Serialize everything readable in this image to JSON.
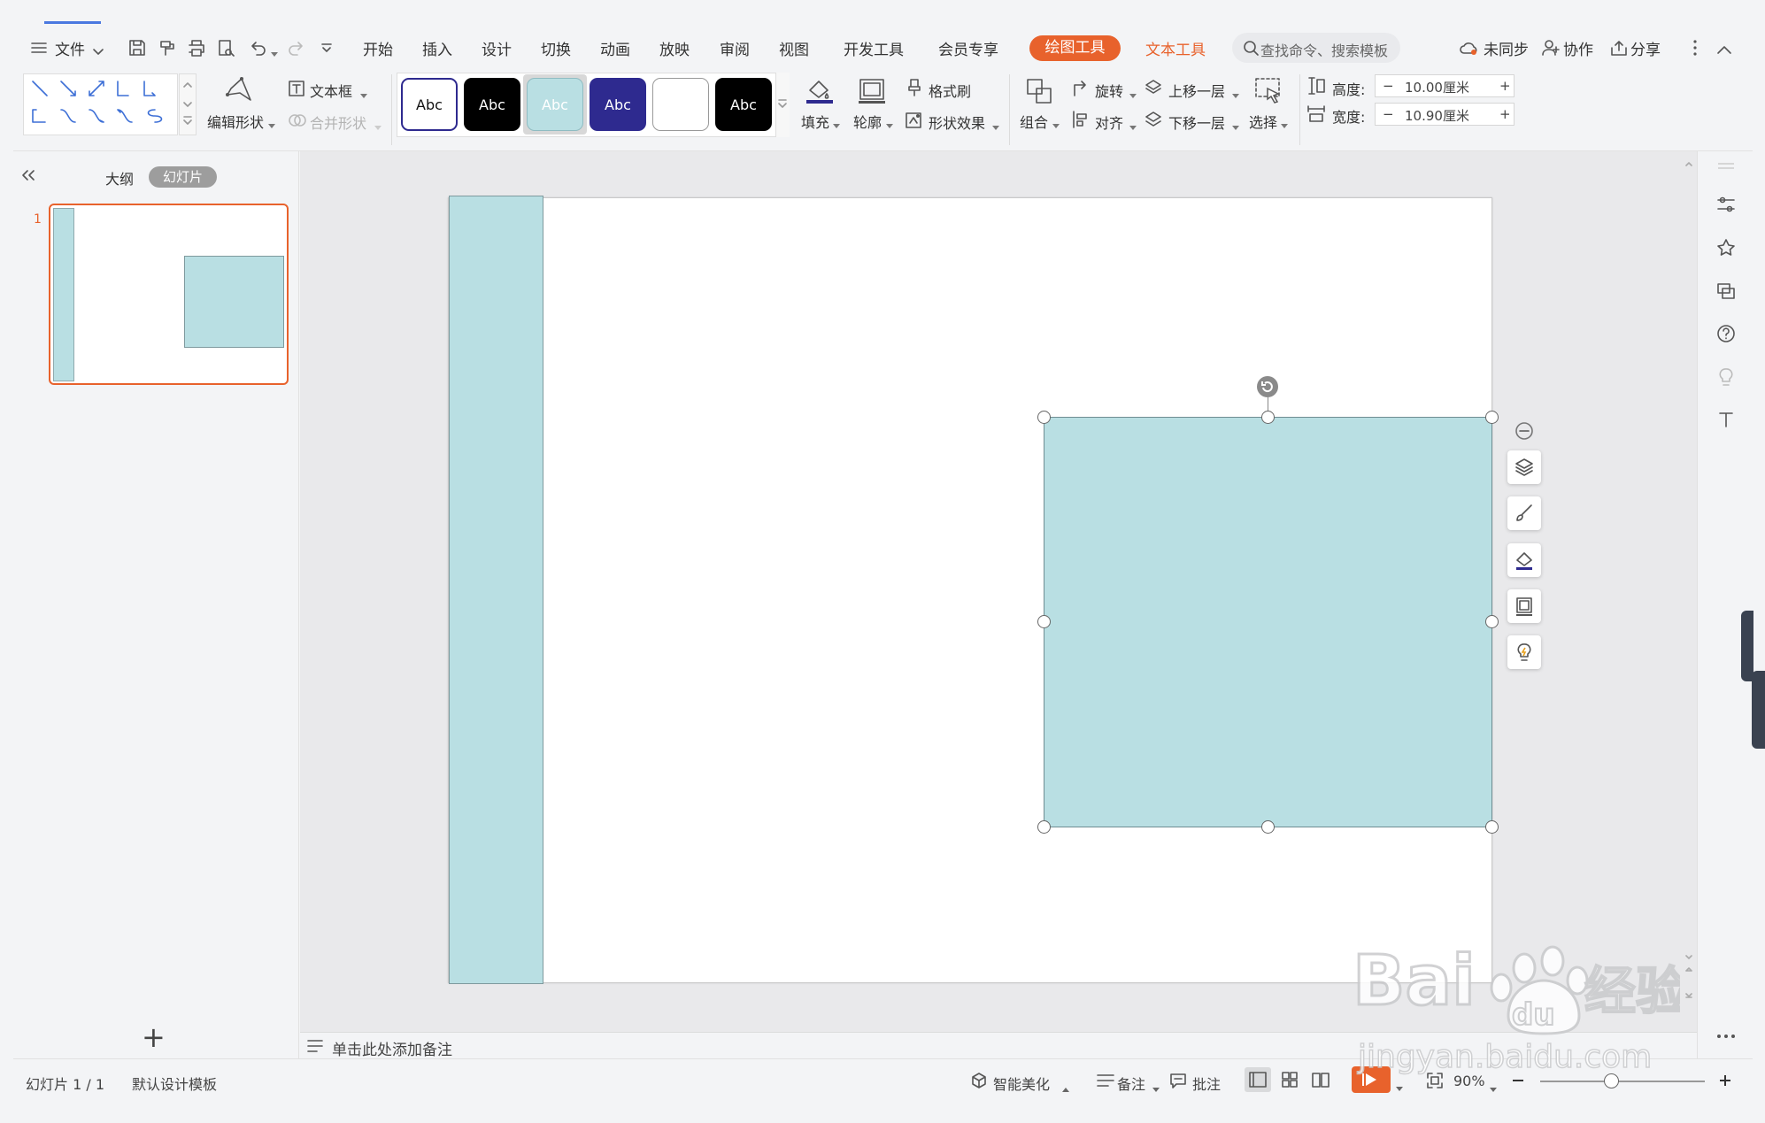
{
  "menu": {
    "file": "文件",
    "tabs": [
      "开始",
      "插入",
      "设计",
      "切换",
      "动画",
      "放映",
      "审阅",
      "视图",
      "开发工具",
      "会员专享"
    ],
    "drawing_tools": "绘图工具",
    "text_tools": "文本工具",
    "search_placeholder": "查找命令、搜索模板",
    "unsynced": "未同步",
    "collaborate": "协作",
    "share": "分享"
  },
  "ribbon": {
    "edit_shape": "编辑形状",
    "text_box": "文本框",
    "merge_shape": "合并形状",
    "style_label": "Abc",
    "fill": "填充",
    "outline": "轮廓",
    "format_painter": "格式刷",
    "shape_effects": "形状效果",
    "group": "组合",
    "rotate": "旋转",
    "align": "对齐",
    "bring_forward": "上移一层",
    "send_backward": "下移一层",
    "select": "选择",
    "height_label": "高度:",
    "height_value": "10.00厘米",
    "width_label": "宽度:",
    "width_value": "10.90厘米",
    "minus": "−",
    "plus": "+"
  },
  "panel": {
    "outline_tab": "大纲",
    "slides_tab": "幻灯片",
    "slide_number": "1",
    "add_slide": "+"
  },
  "notes": {
    "placeholder": "单击此处添加备注"
  },
  "status": {
    "slide_info": "幻灯片 1 / 1",
    "template": "默认设计模板",
    "smart_beautify": "智能美化",
    "notes": "备注",
    "comments": "批注",
    "zoom": "90%"
  },
  "colors": {
    "shape_fill": "#b9dfe3",
    "accent_orange": "#e8622c",
    "style_dark_blue": "#2e2a8f"
  },
  "watermark": "Baidu经验 jingyan.baidu.com"
}
